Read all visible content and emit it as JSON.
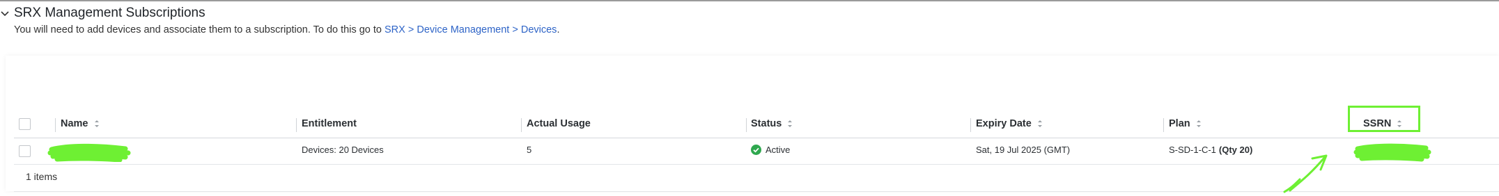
{
  "section": {
    "title": "SRX Management Subscriptions",
    "desc_prefix": "You will need to add devices and associate them to a subscription. To do this go to ",
    "desc_link": "SRX > Device Management > Devices",
    "desc_suffix": "."
  },
  "table": {
    "columns": [
      "Name",
      "Entitlement",
      "Actual Usage",
      "Status",
      "Expiry Date",
      "Plan",
      "SSRN"
    ],
    "rows": [
      {
        "name": "",
        "entitlement": "Devices: 20 Devices",
        "actual_usage": "5",
        "status": "Active",
        "expiry_date": "Sat, 19 Jul 2025 (GMT)",
        "plan_code": "S-SD-1-C-1",
        "plan_qty": "(Qty 20)",
        "ssrn": ""
      }
    ],
    "footer": "1 items"
  },
  "colors": {
    "accent_link": "#2e64c7",
    "status_active": "#2fa84f",
    "annotation_green": "#6ef033"
  },
  "icons": {
    "collapse": "chevron-down-icon",
    "sort": "sort-icon",
    "status": "check-circle-icon"
  }
}
